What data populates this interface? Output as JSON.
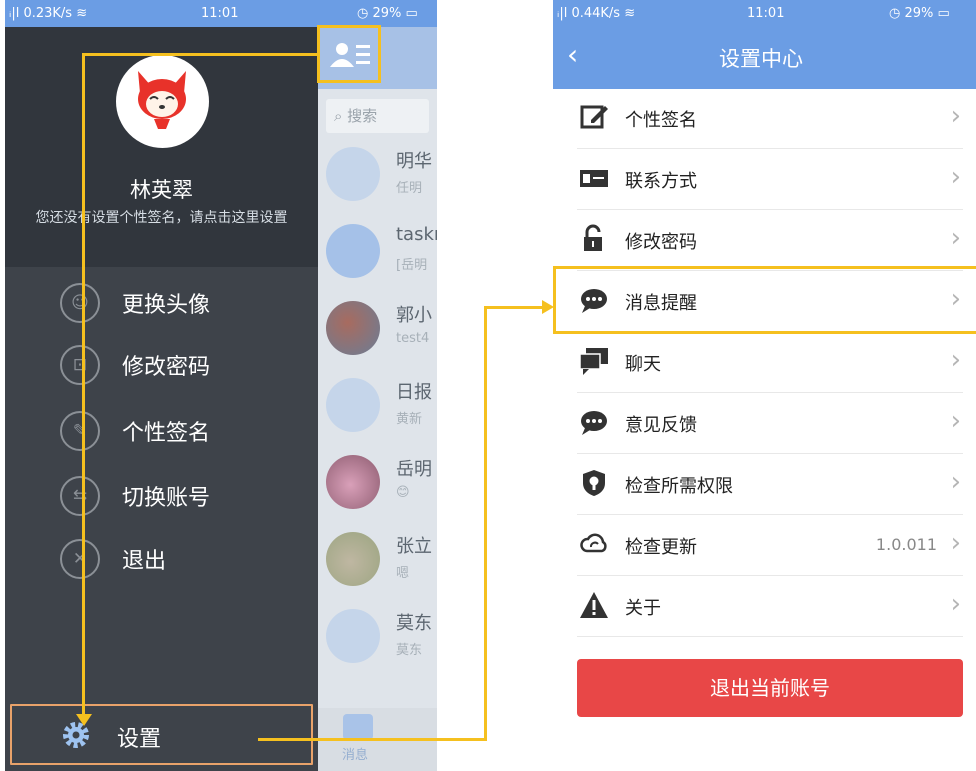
{
  "left_phone": {
    "status_bar": {
      "network": "0.23K/s",
      "time": "11:01",
      "battery": "29%"
    },
    "drawer": {
      "username": "林英翠",
      "signature_hint": "您还没有设置个性签名，请点击这里设置",
      "menu": [
        {
          "label": "更换头像",
          "icon": "user-icon"
        },
        {
          "label": "修改密码",
          "icon": "lock-icon"
        },
        {
          "label": "个性签名",
          "icon": "edit-icon"
        },
        {
          "label": "切换账号",
          "icon": "switch-icon"
        },
        {
          "label": "退出",
          "icon": "exit-icon"
        }
      ],
      "settings_label": "设置"
    },
    "chat_list": {
      "search_placeholder": "搜索",
      "items": [
        {
          "name": "明华",
          "snippet": "任明"
        },
        {
          "name": "taskr",
          "snippet": "[岳明"
        },
        {
          "name": "郭小",
          "snippet": "test4"
        },
        {
          "name": "日报",
          "snippet": "黄新"
        },
        {
          "name": "岳明",
          "snippet": "😊"
        },
        {
          "name": "张立",
          "snippet": "嗯"
        },
        {
          "name": "莫东",
          "snippet": "莫东"
        }
      ],
      "tab_label": "消息"
    }
  },
  "right_phone": {
    "status_bar": {
      "network": "0.44K/s",
      "time": "11:01",
      "battery": "29%"
    },
    "nav_title": "设置中心",
    "rows": [
      {
        "label": "个性签名",
        "icon": "edit-icon"
      },
      {
        "label": "联系方式",
        "icon": "contact-card-icon"
      },
      {
        "label": "修改密码",
        "icon": "unlock-icon"
      },
      {
        "label": "消息提醒",
        "icon": "chat-bubble-icon"
      },
      {
        "label": "聊天",
        "icon": "chat-icon"
      },
      {
        "label": "意见反馈",
        "icon": "feedback-icon"
      },
      {
        "label": "检查所需权限",
        "icon": "shield-icon"
      },
      {
        "label": "检查更新",
        "icon": "cloud-sync-icon",
        "value": "1.0.011"
      },
      {
        "label": "关于",
        "icon": "warning-icon"
      }
    ],
    "logout_label": "退出当前账号"
  },
  "colors": {
    "accent": "#6b9de4",
    "drawer": "#3e434a",
    "highlight": "#f5c01f",
    "logout": "#e84747"
  }
}
